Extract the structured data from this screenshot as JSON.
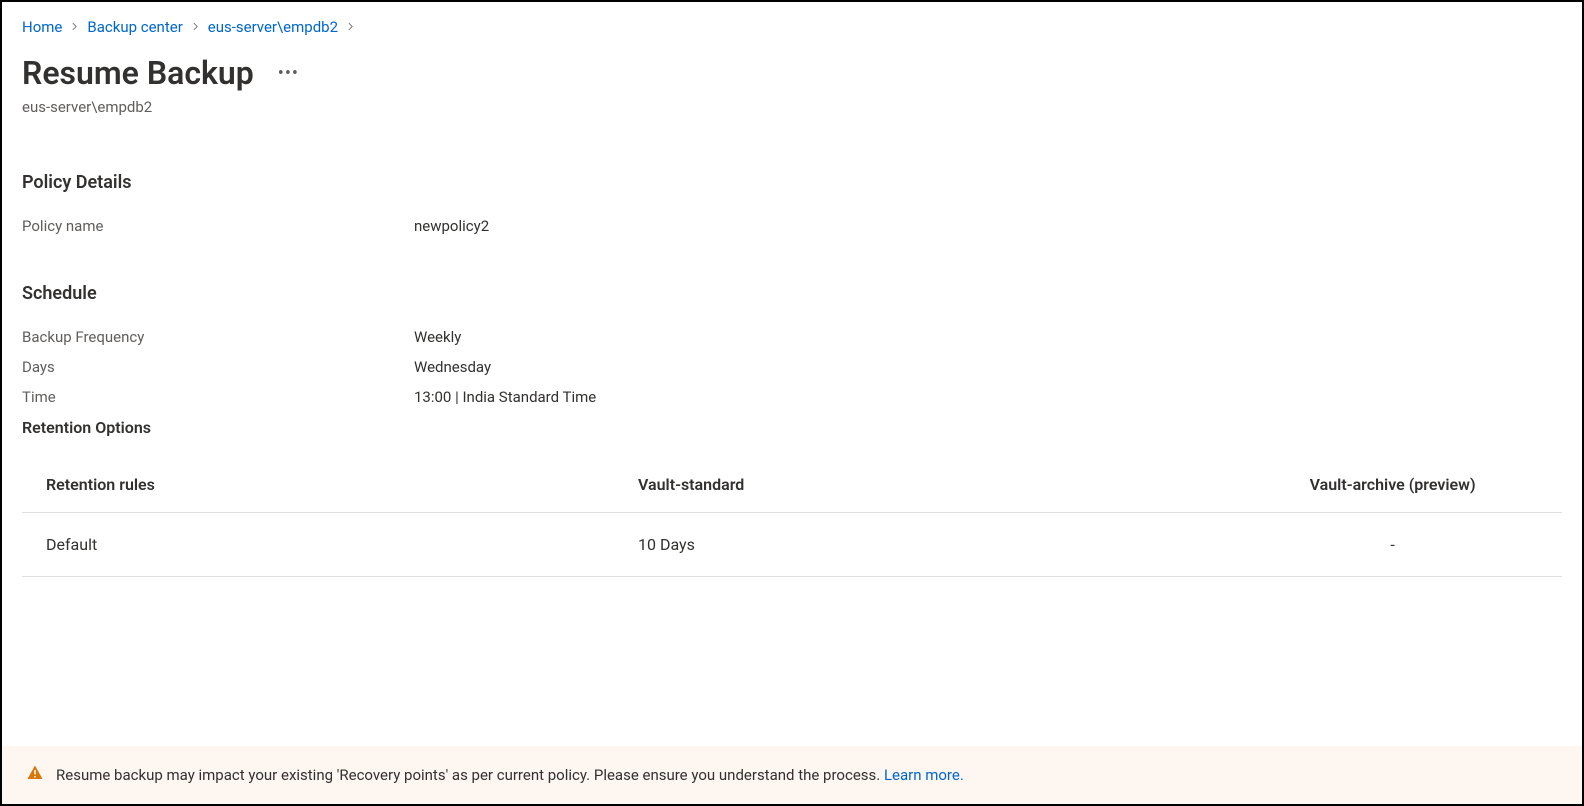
{
  "breadcrumb": {
    "items": [
      {
        "label": "Home"
      },
      {
        "label": "Backup center"
      },
      {
        "label": "eus-server\\empdb2"
      }
    ]
  },
  "header": {
    "title": "Resume Backup",
    "subtitle": "eus-server\\empdb2"
  },
  "policy_details": {
    "heading": "Policy Details",
    "name_label": "Policy name",
    "name_value": "newpolicy2"
  },
  "schedule": {
    "heading": "Schedule",
    "frequency_label": "Backup Frequency",
    "frequency_value": "Weekly",
    "days_label": "Days",
    "days_value": "Wednesday",
    "time_label": "Time",
    "time_value": "13:00 | India Standard Time"
  },
  "retention": {
    "heading": "Retention Options",
    "columns": {
      "rules": "Retention rules",
      "standard": "Vault-standard",
      "archive": "Vault-archive (preview)"
    },
    "rows": [
      {
        "rule": "Default",
        "standard": "10 Days",
        "archive": "-"
      }
    ]
  },
  "warning": {
    "text": "Resume backup may impact your existing 'Recovery points' as per current policy. Please ensure you understand the process. ",
    "link": "Learn more."
  }
}
